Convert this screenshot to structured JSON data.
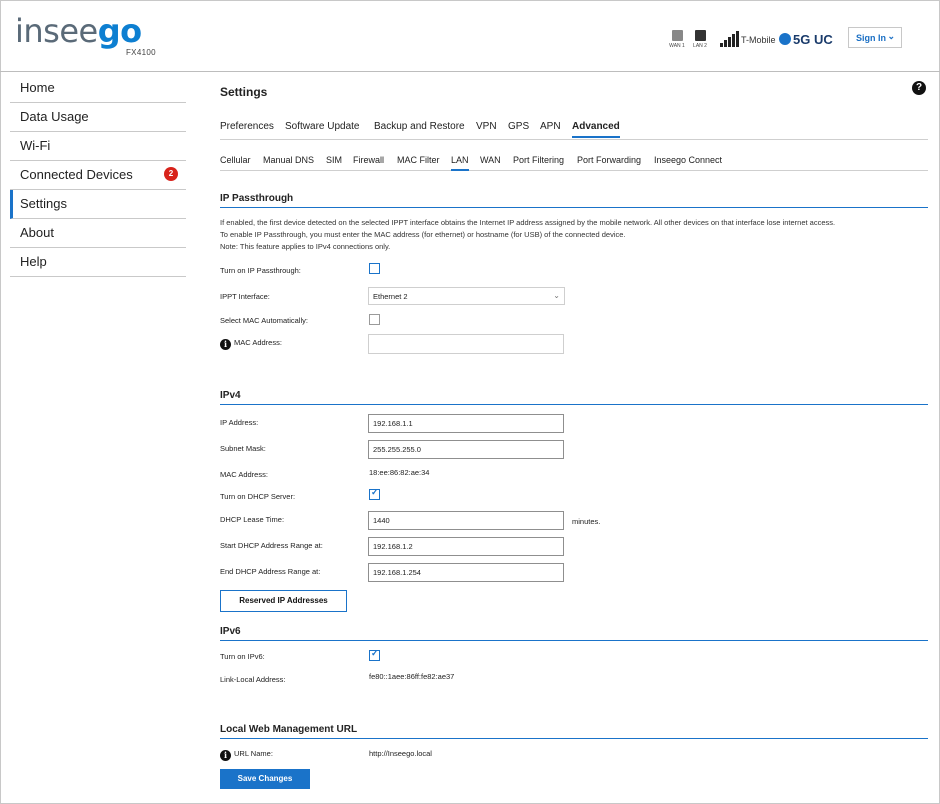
{
  "header": {
    "logo_part1": "insee",
    "logo_part2": "go",
    "model": "FX4100",
    "wan1": "WAN 1",
    "lan2": "LAN 2",
    "carrier": "T-Mobile",
    "network": "5G UC",
    "sign_in": "Sign In"
  },
  "sidebar": {
    "items": [
      {
        "label": "Home"
      },
      {
        "label": "Data Usage"
      },
      {
        "label": "Wi-Fi"
      },
      {
        "label": "Connected Devices",
        "badge": "2"
      },
      {
        "label": "Settings"
      },
      {
        "label": "About"
      },
      {
        "label": "Help"
      }
    ],
    "active": "Settings"
  },
  "main": {
    "title": "Settings",
    "help": "?",
    "tabs": [
      "Preferences",
      "Software Update",
      "Backup and Restore",
      "VPN",
      "GPS",
      "APN",
      "Advanced"
    ],
    "active_tab": "Advanced",
    "subtabs": [
      "Cellular",
      "Manual DNS",
      "SIM",
      "Firewall",
      "MAC Filter",
      "LAN",
      "WAN",
      "Port Filtering",
      "Port Forwarding",
      "Inseego Connect"
    ],
    "active_subtab": "LAN"
  },
  "ip_passthrough": {
    "title": "IP Passthrough",
    "desc1": "If enabled, the first device detected on the selected IPPT interface obtains the Internet IP address assigned by the mobile network. All other devices on that interface lose internet access.",
    "desc2": "To enable IP Passthrough, you must enter the MAC address (for ethernet) or hostname (for USB) of the connected device.",
    "desc3": "Note: This feature applies to IPv4 connections only.",
    "turn_on_label": "Turn on IP Passthrough:",
    "turn_on_checked": false,
    "interface_label": "IPPT Interface:",
    "interface_value": "Ethernet 2",
    "auto_mac_label": "Select MAC Automatically:",
    "auto_mac_checked": false,
    "mac_label": "MAC Address:",
    "mac_value": ""
  },
  "ipv4": {
    "title": "IPv4",
    "ip_label": "IP Address:",
    "ip_value": "192.168.1.1",
    "subnet_label": "Subnet Mask:",
    "subnet_value": "255.255.255.0",
    "mac_label": "MAC Address:",
    "mac_value": "18:ee:86:82:ae:34",
    "dhcp_label": "Turn on DHCP Server:",
    "dhcp_checked": true,
    "lease_label": "DHCP Lease Time:",
    "lease_value": "1440",
    "lease_unit": "minutes.",
    "start_label": "Start DHCP Address Range at:",
    "start_value": "192.168.1.2",
    "end_label": "End DHCP Address Range at:",
    "end_value": "192.168.1.254",
    "reserved_button": "Reserved IP Addresses"
  },
  "ipv6": {
    "title": "IPv6",
    "turn_on_label": "Turn on IPv6:",
    "turn_on_checked": true,
    "link_local_label": "Link-Local Address:",
    "link_local_value": "fe80::1aee:86ff:fe82:ae37"
  },
  "local_web": {
    "title": "Local Web Management URL",
    "url_label": "URL Name:",
    "url_value": "http://Inseego.local"
  },
  "save_button": "Save Changes",
  "colors": {
    "accent": "#1a73c9",
    "badge": "#d8231b",
    "logo_grey": "#5a6a78",
    "logo_blue": "#0d7fd1"
  }
}
